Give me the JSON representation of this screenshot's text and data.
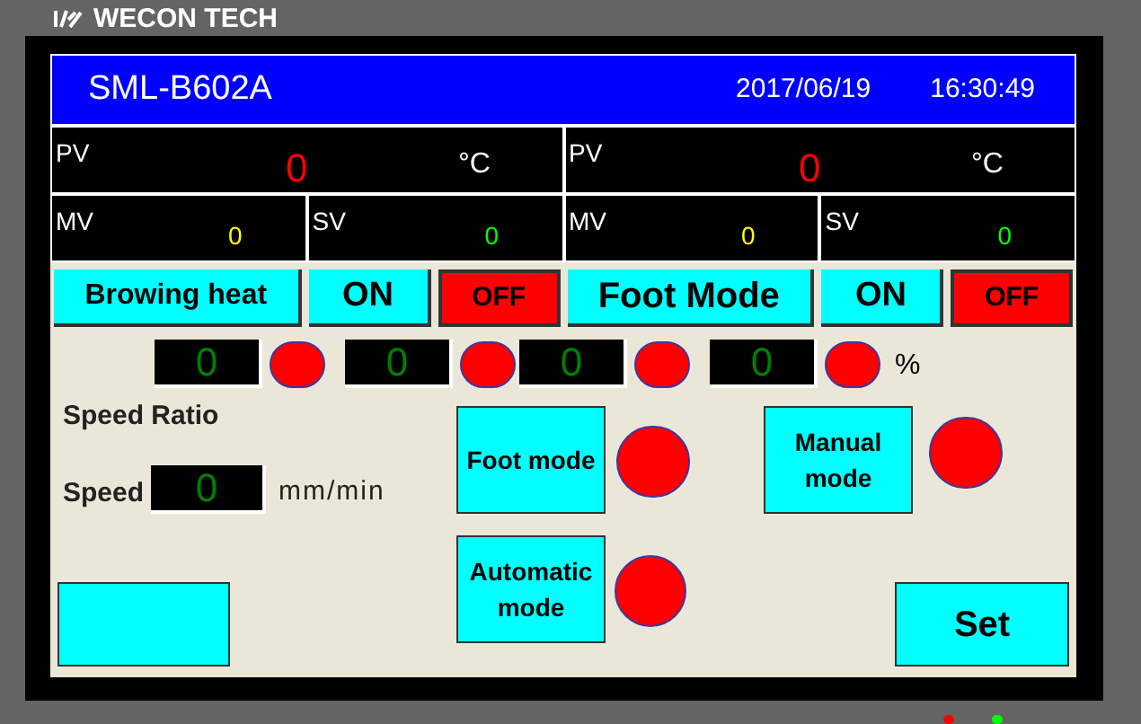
{
  "brand": {
    "name": "WECON TECH"
  },
  "header": {
    "title": "SML-B602A",
    "date": "2017/06/19",
    "time": "16:30:49"
  },
  "pv_panels": [
    {
      "label": "PV",
      "value": "0",
      "unit": "°C"
    },
    {
      "label": "PV",
      "value": "0",
      "unit": "°C"
    }
  ],
  "readouts": [
    {
      "label": "MV",
      "value": "0",
      "color": "#ffff00"
    },
    {
      "label": "SV",
      "value": "0",
      "color": "#00ff00"
    },
    {
      "label": "MV",
      "value": "0",
      "color": "#ffff00"
    },
    {
      "label": "SV",
      "value": "0",
      "color": "#00ff00"
    }
  ],
  "mode_buttons": [
    {
      "kind": "label",
      "label": "Browing heat"
    },
    {
      "kind": "on",
      "label": "ON"
    },
    {
      "kind": "off",
      "label": "OFF"
    },
    {
      "kind": "label",
      "label": "Foot Mode"
    },
    {
      "kind": "on",
      "label": "ON"
    },
    {
      "kind": "off",
      "label": "OFF"
    }
  ],
  "percent_displays": [
    {
      "value": "0",
      "lamp_on": false
    },
    {
      "value": "0",
      "lamp_on": false
    },
    {
      "value": "0",
      "lamp_on": false
    },
    {
      "value": "0",
      "lamp_on": false
    }
  ],
  "percent_unit": "%",
  "speed_ratio_label": "Speed Ratio",
  "speed": {
    "label": "Speed",
    "value": "0",
    "unit": "mm/min"
  },
  "mode_selectors": [
    {
      "label": "Foot mode",
      "lamp_on": false
    },
    {
      "label": "Manual mode",
      "lamp_on": false
    },
    {
      "label": "Automatic mode",
      "lamp_on": false
    }
  ],
  "set_button": {
    "label": "Set"
  },
  "status_leds": [
    {
      "color": "#ff0000"
    },
    {
      "color": "#00ff00"
    }
  ]
}
